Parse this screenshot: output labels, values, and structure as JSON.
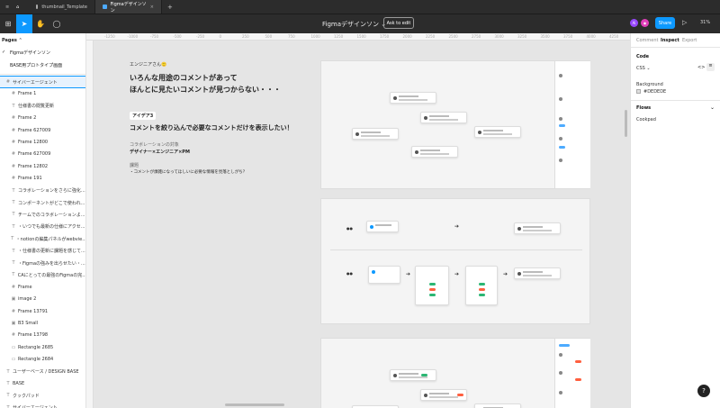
{
  "tabs": [
    {
      "label": "thumbnail_Template"
    },
    {
      "label": "Figmaデザインソン"
    }
  ],
  "file_title": "Figmaデザインソン ⌄",
  "ask_button": "Ask to edit",
  "avatars": [
    {
      "initials": "Ai",
      "color": "#9747ff"
    },
    {
      "initials": "◉",
      "color": "#e03eb8"
    }
  ],
  "share_button": "Share",
  "zoom": "31%",
  "pages": {
    "heading": "Pages ⌃",
    "items": [
      "Figmaデザインソン",
      "BASE用プロトタイプ画面"
    ]
  },
  "layers": [
    {
      "icon": "#",
      "label": "サイバーエージェント",
      "nest": false,
      "sel": true
    },
    {
      "icon": "#",
      "label": "Frame 1",
      "nest": true
    },
    {
      "icon": "T",
      "label": "仕様書の閲覧更新",
      "nest": true
    },
    {
      "icon": "#",
      "label": "Frame 2",
      "nest": true
    },
    {
      "icon": "#",
      "label": "Frame 627009",
      "nest": true
    },
    {
      "icon": "#",
      "label": "Frame 12800",
      "nest": true
    },
    {
      "icon": "#",
      "label": "Frame 627009",
      "nest": true
    },
    {
      "icon": "#",
      "label": "Frame 12802",
      "nest": true
    },
    {
      "icon": "#",
      "label": "Frame 191",
      "nest": true
    },
    {
      "icon": "T",
      "label": "コラボレーションをさらに強化...",
      "nest": true
    },
    {
      "icon": "T",
      "label": "コンポーネントがどこで使われ...",
      "nest": true
    },
    {
      "icon": "T",
      "label": "チームでのコラボレーションよ...",
      "nest": true
    },
    {
      "icon": "T",
      "label": "・いつでも最新の仕様にアクセ...",
      "nest": true
    },
    {
      "icon": "T",
      "label": "・notionの編集パネルがwebvie...",
      "nest": true
    },
    {
      "icon": "T",
      "label": "・仕様書の更新に課題を感じて...",
      "nest": true
    },
    {
      "icon": "T",
      "label": "・Figmaの強みを出らせたい・...",
      "nest": true
    },
    {
      "icon": "T",
      "label": "CAにとっての最強のFigmaの完...",
      "nest": true
    },
    {
      "icon": "#",
      "label": "Frame",
      "nest": true
    },
    {
      "icon": "▣",
      "label": "image 2",
      "nest": true
    },
    {
      "icon": "#",
      "label": "Frame 13791",
      "nest": true
    },
    {
      "icon": "▣",
      "label": "B3 Small",
      "nest": true
    },
    {
      "icon": "#",
      "label": "Frame 13798",
      "nest": true
    },
    {
      "icon": "▭",
      "label": "Rectangle 2685",
      "nest": true
    },
    {
      "icon": "▭",
      "label": "Rectangle 2684",
      "nest": true
    },
    {
      "icon": "T",
      "label": "ユーザーベース / DESIGN BASE",
      "nest": false
    },
    {
      "icon": "T",
      "label": "BASE",
      "nest": false
    },
    {
      "icon": "T",
      "label": "クックパッド",
      "nest": false
    },
    {
      "icon": "T",
      "label": "サイバーエージェント",
      "nest": false
    }
  ],
  "ruler_marks": [
    "-1250",
    "-1000",
    "-750",
    "-500",
    "-250",
    "0",
    "250",
    "500",
    "750",
    "1000",
    "1250",
    "1500",
    "1750",
    "2000",
    "2250",
    "2500",
    "2750",
    "3000",
    "3250",
    "3500",
    "3750",
    "4000",
    "4250"
  ],
  "canvas_doc": {
    "tag": "エンジニアさん🙂",
    "headline1": "いろんな用途のコメントがあって",
    "headline2": "ほんとに見たいコメントが見つからない・・・",
    "idea_tag": "アイデア3",
    "idea": "コメントを絞り込んで必要なコメントだけを表示したい！",
    "target_label": "コラボレーションの対象",
    "target": "デザイナー×エンジニア×PM",
    "issue_label": "課題",
    "issue": "・コメントが煩雑になってほしいに必要な情報を見落としがち？"
  },
  "right_panel": {
    "tabs": [
      "Comment",
      "Inspect",
      "Export"
    ],
    "code_heading": "Code",
    "code_lang": "CSS ⌄",
    "bg_heading": "Background",
    "bg_color": "#DEDEDE",
    "flows_heading": "Flows",
    "flow_item": "Cookpad"
  },
  "help": "?"
}
